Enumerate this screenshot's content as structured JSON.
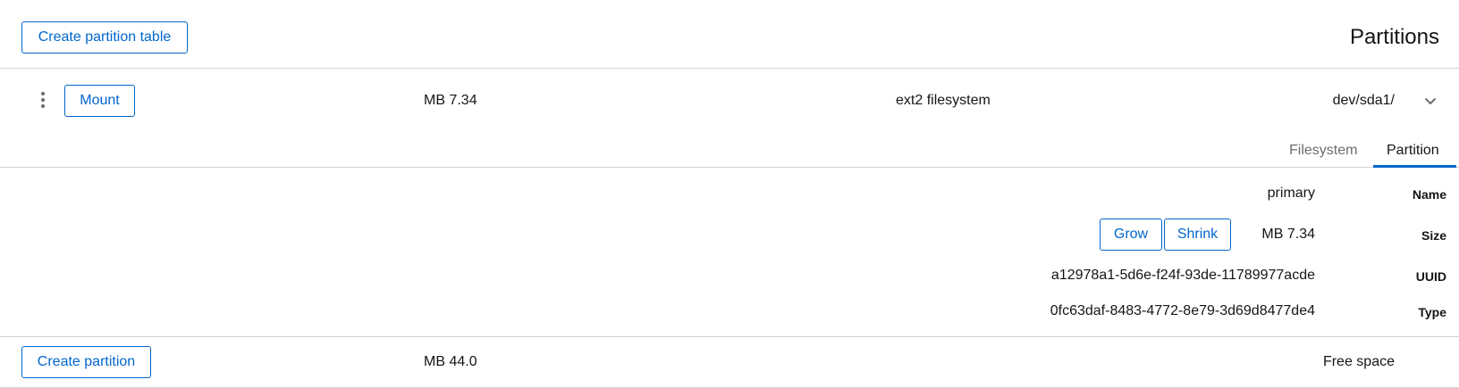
{
  "header": {
    "create_table_label": "Create partition table",
    "title": "Partitions"
  },
  "partition": {
    "actions_icon": "kebab-icon",
    "mount_label": "Mount",
    "size": "MB 7.34",
    "description": "ext2 filesystem",
    "device": "dev/sda1/",
    "expand_icon": "chevron-down-icon",
    "expanded": true,
    "tabs": [
      {
        "label": "Filesystem",
        "active": false
      },
      {
        "label": "Partition",
        "active": true
      }
    ],
    "details": {
      "name_label": "Name",
      "name_value": "primary",
      "size_label": "Size",
      "size_value": "MB 7.34",
      "grow_label": "Grow",
      "shrink_label": "Shrink",
      "uuid_label": "UUID",
      "uuid_value": "a12978a1-5d6e-f24f-93de-11789977acde",
      "type_label": "Type",
      "type_value": "0fc63daf-8483-4772-8e79-3d69d8477de4"
    }
  },
  "free_space": {
    "create_label": "Create partition",
    "size": "MB 44.0",
    "description": "Free space"
  },
  "colors": {
    "accent": "#0066cc",
    "border": "#d2d2d2",
    "muted_text": "#6a6e73"
  }
}
